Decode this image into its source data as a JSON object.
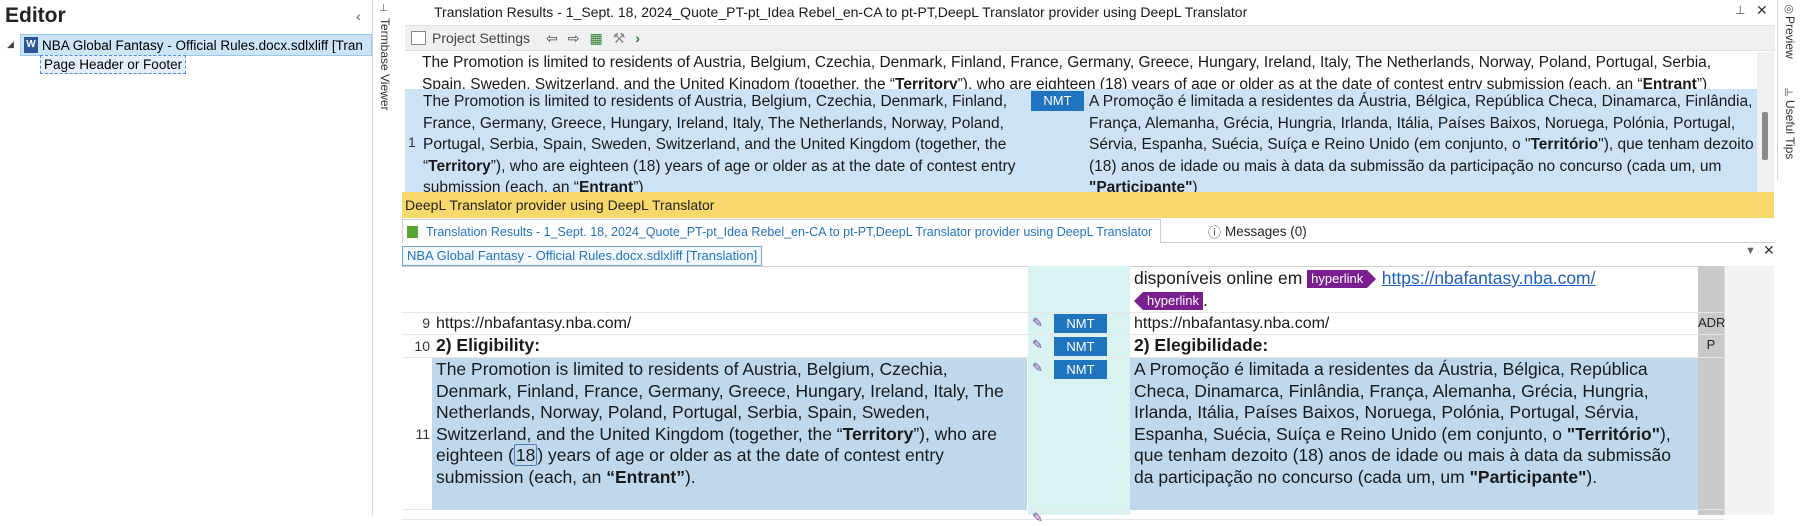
{
  "editor": {
    "title": "Editor",
    "collapse_glyph": "‹",
    "tree": {
      "root_label": "NBA Global Fantasy - Official Rules.docx.sdlxliff [Tran",
      "child_label": "Page Header or Footer"
    }
  },
  "side_tabs": {
    "termbase_viewer": "Termbase Viewer",
    "preview": "Preview",
    "useful_tips": "Useful Tips"
  },
  "translation_results": {
    "title": "Translation Results - 1_Sept. 18, 2024_Quote_PT-pt_Idea Rebel_en-CA to pt-PT,DeepL Translator provider using DeepL Translator",
    "toolbar": {
      "project_settings": "Project Settings"
    },
    "previous_line_1": "The Promotion is limited to residents of Austria, Belgium, Czechia, Denmark, Finland, France, Germany, Greece, Hungary, Ireland, Italy, The Netherlands, Norway, Poland, Portugal, Serbia,",
    "previous_line_2_a": "Spain, Sweden, Switzerland, and the United Kingdom (together, the “",
    "previous_line_2_b": "Territory",
    "previous_line_2_c": "”), who are eighteen (18) years of age or older as at the date of contest entry submission (each, an “",
    "previous_line_2_d": "Entrant",
    "previous_line_2_e": "”)",
    "row_number": "1",
    "source_a": "The Promotion is limited to residents of Austria, Belgium, Czechia, Denmark, Finland, France, Germany, Greece, Hungary, Ireland, Italy, The Netherlands, Norway, Poland, Portugal, Serbia, Spain, Sweden, Switzerland, and the United Kingdom (together, the “",
    "source_b": "Territory",
    "source_c": "”), who are eighteen (18) years of age or older as at the date of contest entry submission (each, an “",
    "source_d": "Entrant",
    "source_e": "”)",
    "match_badge": "NMT",
    "target_a": "A Promoção é limitada a residentes da Áustria, Bélgica, República Checa, Dinamarca, Finlândia, França, Alemanha, Grécia, Hungria, Irlanda, Itália, Países Baixos, Noruega, Polónia, Portugal, Sérvia, Espanha, Suécia, Suíça e Reino Unido (em conjunto, o \"",
    "target_b": "Território",
    "target_c": "\"), que tenham dezoito (18) anos de idade ou mais à data da submissão da participação no concurso (cada um, um ",
    "target_d": "\"Participante\"",
    "target_e": ")",
    "provider_bar": "DeepL Translator provider using DeepL Translator"
  },
  "tabs": {
    "translation_results_tab": "Translation Results - 1_Sept. 18, 2024_Quote_PT-pt_Idea Rebel_en-CA to pt-PT,DeepL Translator provider using DeepL Translator",
    "messages_tab": "Messages (0)"
  },
  "document": {
    "tab_label": "NBA Global Fantasy - Official Rules.docx.sdlxliff [Translation]",
    "row8_target_a": "disponíveis online em",
    "row8_tag_open": "hyperlink",
    "row8_url": "https://nbafantasy.nba.com/",
    "row8_tag_close": "hyperlink",
    "row8_target_end": ".",
    "rows": [
      {
        "num": "9",
        "source": "https://nbafantasy.nba.com/",
        "badge": "NMT",
        "target": "https://nbafantasy.nba.com/",
        "extra": "ADR"
      },
      {
        "num": "10",
        "source": "2) Eligibility:",
        "badge": "NMT",
        "target": "2) Elegibilidade:",
        "extra": "P"
      }
    ],
    "row11": {
      "num": "11",
      "badge": "NMT",
      "source_a": "The Promotion is limited to residents of Austria, Belgium, Czechia, Denmark, Finland, France, Germany, Greece, Hungary, Ireland, Italy, The Netherlands, Norway, Poland, Portugal, Serbia, Spain, Sweden, Switzerland, and the United Kingdom (together, the “",
      "source_b": "Territory",
      "source_c": "”), who are eighteen (",
      "source_num": "18",
      "source_d": ") years of age or older as at the date of contest entry submission (each, an ",
      "source_e": "“Entrant”",
      "source_f": ").",
      "target_a": "A Promoção é limitada a residentes da Áustria, Bélgica, República Checa, Dinamarca, Finlândia, França, Alemanha, Grécia, Hungria, Irlanda, Itália, Países Baixos, Noruega, Polónia, Portugal, Sérvia, Espanha, Suécia, Suíça e Reino Unido (em conjunto, o ",
      "target_b": "\"Território\"",
      "target_c": "), que tenham dezoito (18) anos de idade ou mais à data da submissão da participação no concurso (cada um, um ",
      "target_d": "\"Participante\"",
      "target_e": ")."
    }
  },
  "colors": {
    "accent_blue": "#1f74c0",
    "selection_blue": "#cde3f5",
    "provider_yellow": "#f8d86a",
    "tag_purple": "#7a1f8f",
    "status_teal": "#d8f3f1"
  },
  "icons": [
    "pin-icon",
    "close-icon",
    "arrow-left-icon",
    "arrow-right-icon",
    "chevron-right-icon",
    "pencil-icon",
    "document-icon",
    "info-icon",
    "dropdown-icon"
  ]
}
